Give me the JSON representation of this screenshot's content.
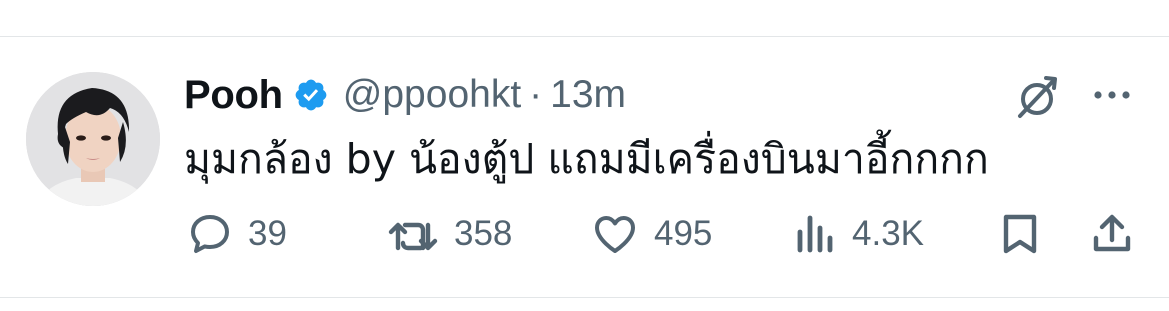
{
  "tweet": {
    "author_name": "Pooh",
    "handle": "@ppoohkt",
    "separator": "·",
    "time": "13m",
    "text": "มุมกล้อง by น้องตู้ป แถมมีเครื่องบินมาอี้กกกก",
    "verified_color": "#1d9bf0"
  },
  "actions": {
    "replies": "39",
    "reposts": "358",
    "likes": "495",
    "views": "4.3K"
  },
  "colors": {
    "text_primary": "#0f1419",
    "text_secondary": "#536471",
    "divider": "#e3e6e8"
  },
  "icons": [
    "verified-badge-icon",
    "grok-icon",
    "more-icon",
    "reply-icon",
    "repost-icon",
    "like-icon",
    "views-icon",
    "bookmark-icon",
    "share-icon"
  ]
}
